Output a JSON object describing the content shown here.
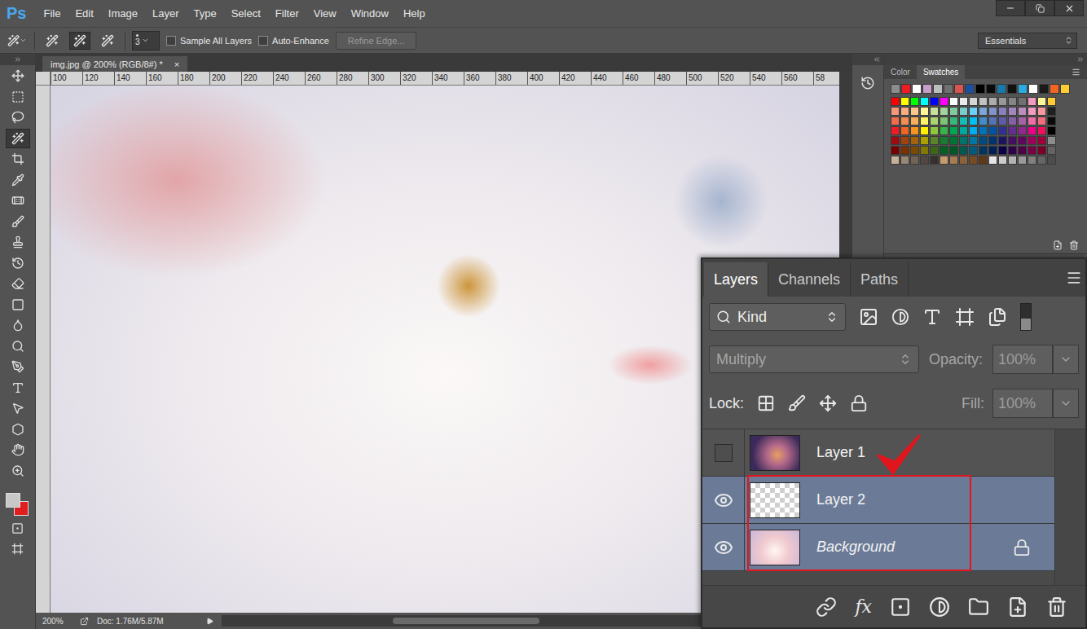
{
  "app": {
    "logo": "Ps"
  },
  "menu": [
    "File",
    "Edit",
    "Image",
    "Layer",
    "Type",
    "Select",
    "Filter",
    "View",
    "Window",
    "Help"
  ],
  "options_bar": {
    "brush_modes": [
      {
        "selected": false
      },
      {
        "selected": true
      },
      {
        "selected": false
      }
    ],
    "brush_size": "3",
    "checkboxes": [
      {
        "label": "Sample All Layers",
        "checked": false
      },
      {
        "label": "Auto-Enhance",
        "checked": false
      }
    ],
    "refine_edge": {
      "label": "Refine Edge...",
      "disabled": true
    },
    "workspace": "Essentials"
  },
  "toolbox": {
    "tools": [
      {
        "kind": "move",
        "selected": false
      },
      {
        "kind": "marquee",
        "selected": false
      },
      {
        "kind": "lasso",
        "selected": false
      },
      {
        "kind": "quick-selection",
        "selected": true
      },
      {
        "kind": "crop",
        "selected": false
      },
      {
        "kind": "eyedropper",
        "selected": false
      },
      {
        "kind": "healing",
        "selected": false
      },
      {
        "kind": "brush",
        "selected": false
      },
      {
        "kind": "stamp",
        "selected": false
      },
      {
        "kind": "history-brush",
        "selected": false
      },
      {
        "kind": "eraser",
        "selected": false
      },
      {
        "kind": "gradient",
        "selected": false
      },
      {
        "kind": "blur",
        "selected": false
      },
      {
        "kind": "dodge",
        "selected": false
      },
      {
        "kind": "pen",
        "selected": false
      },
      {
        "kind": "type",
        "selected": false
      },
      {
        "kind": "path-selection",
        "selected": false
      },
      {
        "kind": "shape",
        "selected": false
      },
      {
        "kind": "hand",
        "selected": false
      },
      {
        "kind": "zoom",
        "selected": false
      }
    ],
    "foreground": "#c8c8c8",
    "background": "#e01e1e"
  },
  "document": {
    "tab": "img.jpg @ 200% (RGB/8#) *",
    "close": "×",
    "ruler_ticks": [
      "100",
      "120",
      "140",
      "160",
      "180",
      "200",
      "220",
      "240",
      "260",
      "280",
      "300",
      "320",
      "340",
      "360",
      "380",
      "400",
      "420",
      "440",
      "460",
      "480",
      "500",
      "520",
      "540",
      "560",
      "58"
    ],
    "zoom": "200%",
    "doc_info": "Doc: 1.76M/5.87M"
  },
  "swatches_panel": {
    "tabs": [
      {
        "label": "Color",
        "selected": false
      },
      {
        "label": "Swatches",
        "selected": true
      }
    ],
    "top_row": [
      "#8c8c8c",
      "#ee1d24",
      "#ffffff",
      "#c79ec7",
      "#bdbdbd",
      "#707070",
      "#d9534f",
      "#1c4f9c",
      "#000000",
      "#0a0a0a",
      "#1979a8",
      "#111111",
      "#29abe2",
      "#ffffff",
      "#1a1a1a",
      "#f26522",
      "#ffcc33"
    ],
    "grid": [
      [
        "#ff0000",
        "#ffff00",
        "#00ff00",
        "#00ffff",
        "#0000ff",
        "#ff00ff",
        "#ffffff",
        "#ebebeb",
        "#d6d6d6",
        "#c2c2c2",
        "#adadad",
        "#999999",
        "#858585",
        "#707070",
        "#f49bc1",
        "#fff799",
        "#ffcc33"
      ],
      [
        "#f7977a",
        "#fbad82",
        "#fdc68c",
        "#fff799",
        "#c6df9c",
        "#a4d49d",
        "#81ca9d",
        "#7bcdc9",
        "#6ccff7",
        "#7ca6d8",
        "#8293ca",
        "#8881be",
        "#a286bd",
        "#bc8cbf",
        "#f49bc1",
        "#f5999d",
        "#1f1f1f"
      ],
      [
        "#f16c4d",
        "#f68e54",
        "#fbaf5a",
        "#fff467",
        "#acd372",
        "#7dc473",
        "#39b778",
        "#16bcb4",
        "#00bff3",
        "#438ccb",
        "#5573b7",
        "#5e5ca7",
        "#855fa8",
        "#a763a9",
        "#ef6ea8",
        "#f16d7e",
        "#0a0a0a"
      ],
      [
        "#ee1d24",
        "#f16522",
        "#f7941d",
        "#fff100",
        "#8fc63d",
        "#37b44a",
        "#00a650",
        "#00a99e",
        "#00aeef",
        "#0072bc",
        "#0054a5",
        "#2f3192",
        "#652c91",
        "#91278f",
        "#ed008c",
        "#ee105a",
        "#000000"
      ],
      [
        "#9d0a0f",
        "#a1410d",
        "#a36209",
        "#aba000",
        "#588528",
        "#197b30",
        "#007236",
        "#00736a",
        "#0076a4",
        "#004a80",
        "#003370",
        "#1d1363",
        "#450e61",
        "#62055f",
        "#9e005c",
        "#9d0039",
        "#8c8c8c"
      ],
      [
        "#790000",
        "#7b3000",
        "#7c4900",
        "#827a00",
        "#3e6617",
        "#045f20",
        "#005824",
        "#005951",
        "#005b7e",
        "#003562",
        "#002056",
        "#0c004b",
        "#30004a",
        "#4b0048",
        "#7a0045",
        "#7a0026",
        "#636363"
      ],
      [
        "#c7b299",
        "#998675",
        "#736357",
        "#534741",
        "#37302d",
        "#c69c6d",
        "#a67c52",
        "#8c6239",
        "#754c24",
        "#603813",
        "#e6e6e6",
        "#cccccc",
        "#b3b3b3",
        "#999999",
        "#808080",
        "#666666",
        "#4d4d4d"
      ]
    ]
  },
  "layers_panel": {
    "tabs": [
      {
        "label": "Layers",
        "selected": true
      },
      {
        "label": "Channels",
        "selected": false
      },
      {
        "label": "Paths",
        "selected": false
      }
    ],
    "filter": "Kind",
    "blend_mode": {
      "value": "Multiply",
      "disabled": true
    },
    "opacity": {
      "label": "Opacity:",
      "value": "100%",
      "disabled": true
    },
    "lock_label": "Lock:",
    "fill": {
      "label": "Fill:",
      "value": "100%",
      "disabled": true
    },
    "layers": [
      {
        "name": "Layer 1",
        "visible": false,
        "selected": false,
        "italic": false,
        "locked": false,
        "kind": "photo-dark"
      },
      {
        "name": "Layer 2",
        "visible": true,
        "selected": true,
        "italic": false,
        "locked": false,
        "kind": "transparent"
      },
      {
        "name": "Background",
        "visible": true,
        "selected": true,
        "italic": true,
        "locked": true,
        "kind": "photo-light"
      }
    ],
    "fx_label": "fx"
  }
}
